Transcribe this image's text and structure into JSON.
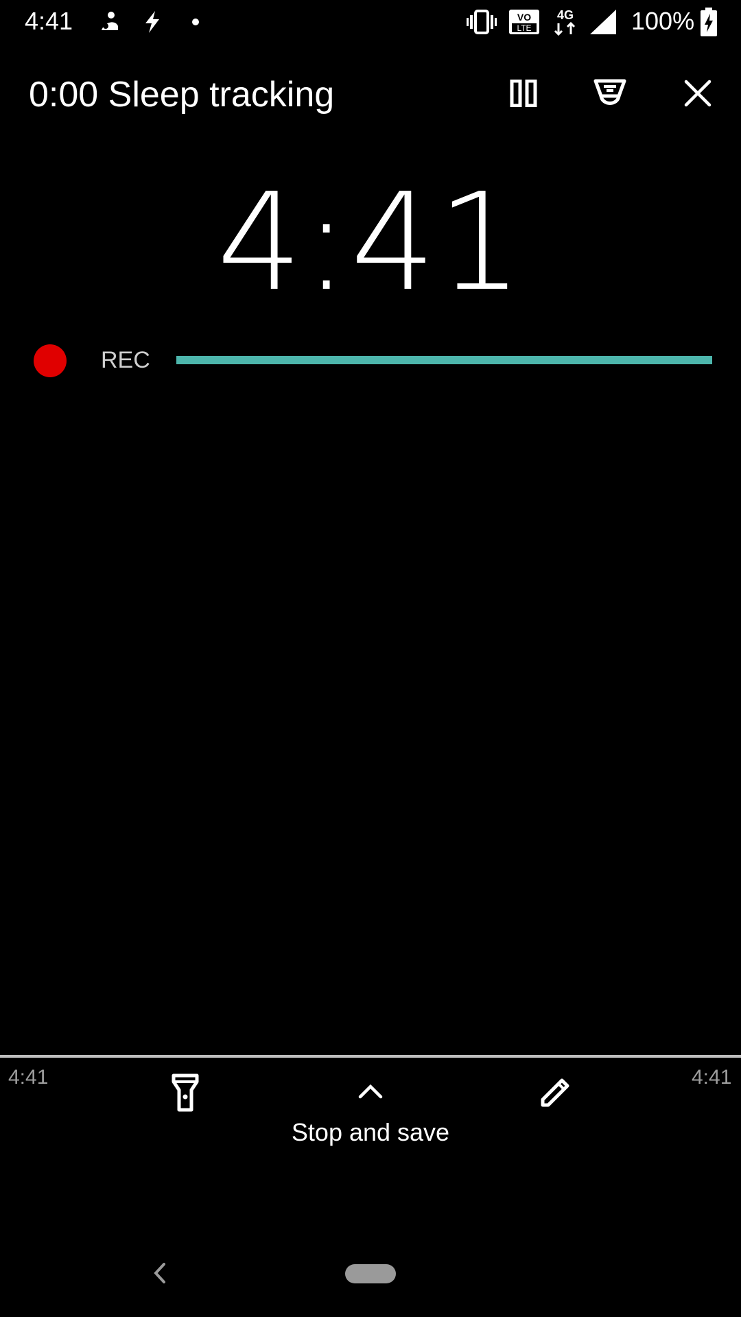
{
  "status_bar": {
    "time": "4:41",
    "battery_percent": "100%",
    "network": "4G",
    "volte": "VO LTE",
    "icons": [
      "assistant-icon",
      "flash-icon",
      "dot-icon",
      "vibrate-icon",
      "volte-icon",
      "4g-icon",
      "signal-icon",
      "battery-icon"
    ]
  },
  "app_bar": {
    "title": "0:00 Sleep tracking",
    "actions": [
      "pause-icon",
      "lullaby-icon",
      "close-icon"
    ]
  },
  "clock": {
    "time": "4:41"
  },
  "recording": {
    "label": "REC",
    "dot_color": "#e00000",
    "level_color": "#4db6ac",
    "level": 1.0
  },
  "bottom_panel": {
    "start_time": "4:41",
    "end_time": "4:41",
    "stop_label": "Stop and save",
    "icons": [
      "flashlight-icon",
      "chevron-up-icon",
      "pencil-icon"
    ]
  },
  "colors": {
    "background": "#000000",
    "accent": "#4db6ac",
    "rec": "#e00000"
  }
}
